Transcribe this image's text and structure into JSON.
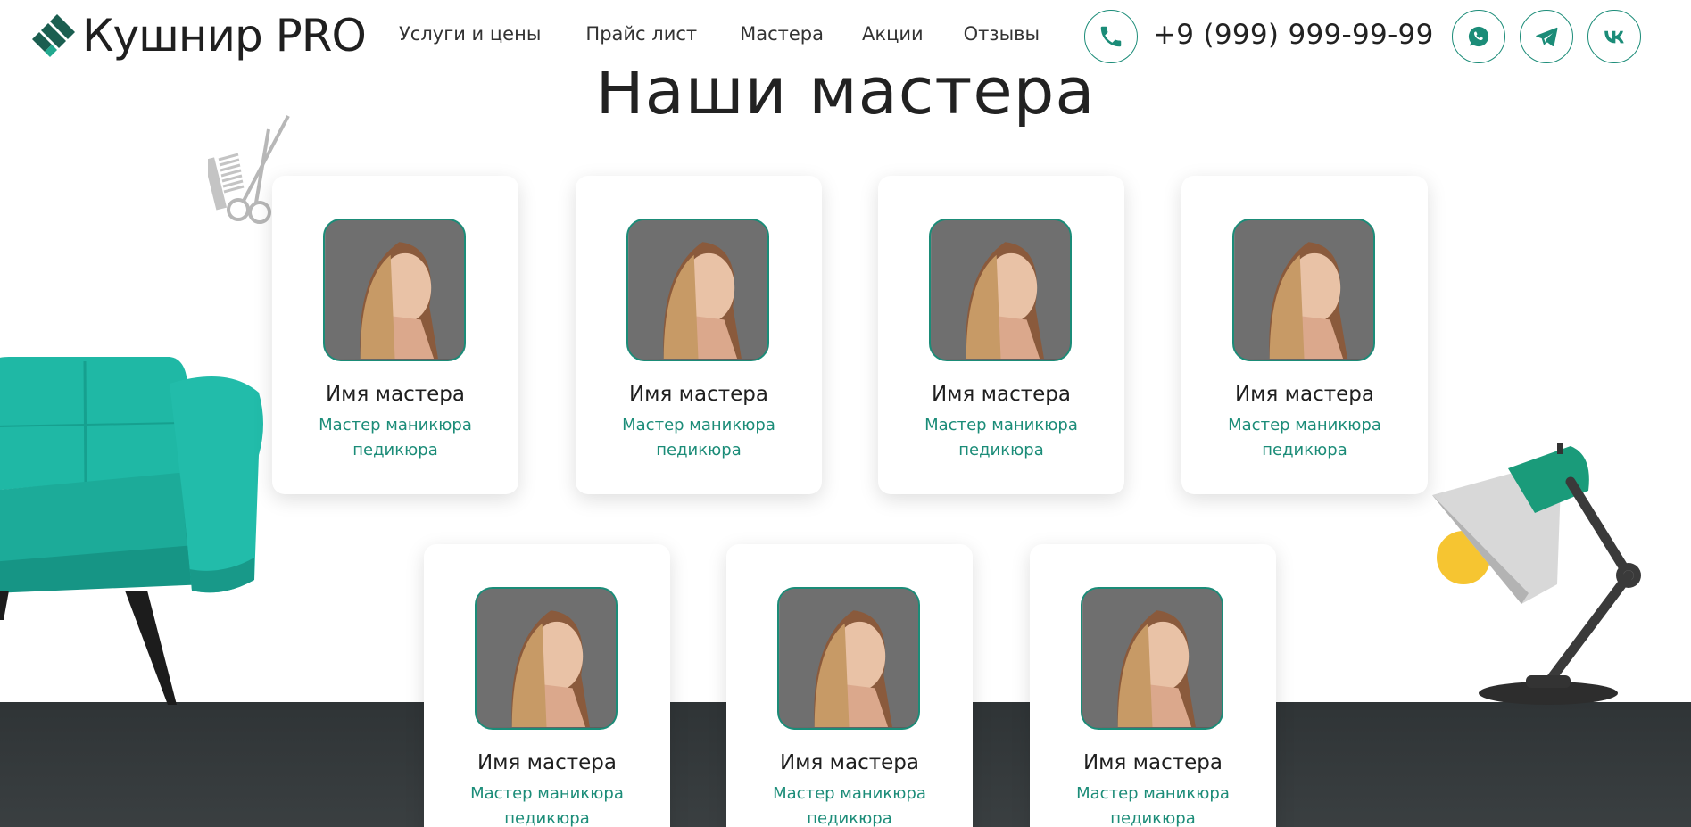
{
  "brand": {
    "logo_text": "Кушнир PRO",
    "accent_color": "#1b8c78",
    "logo_icon": "diagonal-stripes-logo-icon"
  },
  "nav": {
    "items": [
      {
        "label": "Услуги и цены"
      },
      {
        "label": "Прайс лист"
      },
      {
        "label": "Мастера"
      },
      {
        "label": "Акции"
      },
      {
        "label": "Отзывы"
      }
    ]
  },
  "contacts": {
    "phone": "+9 (999) 999-99-99",
    "phone_icon": "phone-icon",
    "socials": [
      {
        "icon": "whatsapp-icon"
      },
      {
        "icon": "telegram-icon"
      },
      {
        "icon": "vk-icon"
      }
    ]
  },
  "section": {
    "title": "Наши мастера"
  },
  "masters": [
    {
      "name": "Имя мастера",
      "role": "Мастер маникюра педикюра"
    },
    {
      "name": "Имя мастера",
      "role": "Мастер маникюра педикюра"
    },
    {
      "name": "Имя мастера",
      "role": "Мастер маникюра педикюра"
    },
    {
      "name": "Имя мастера",
      "role": "Мастер маникюра педикюра"
    },
    {
      "name": "Имя мастера",
      "role": "Мастер маникюра педикюра"
    },
    {
      "name": "Имя мастера",
      "role": "Мастер маникюра педикюра"
    },
    {
      "name": "Имя мастера",
      "role": "Мастер маникюра педикюра"
    }
  ]
}
